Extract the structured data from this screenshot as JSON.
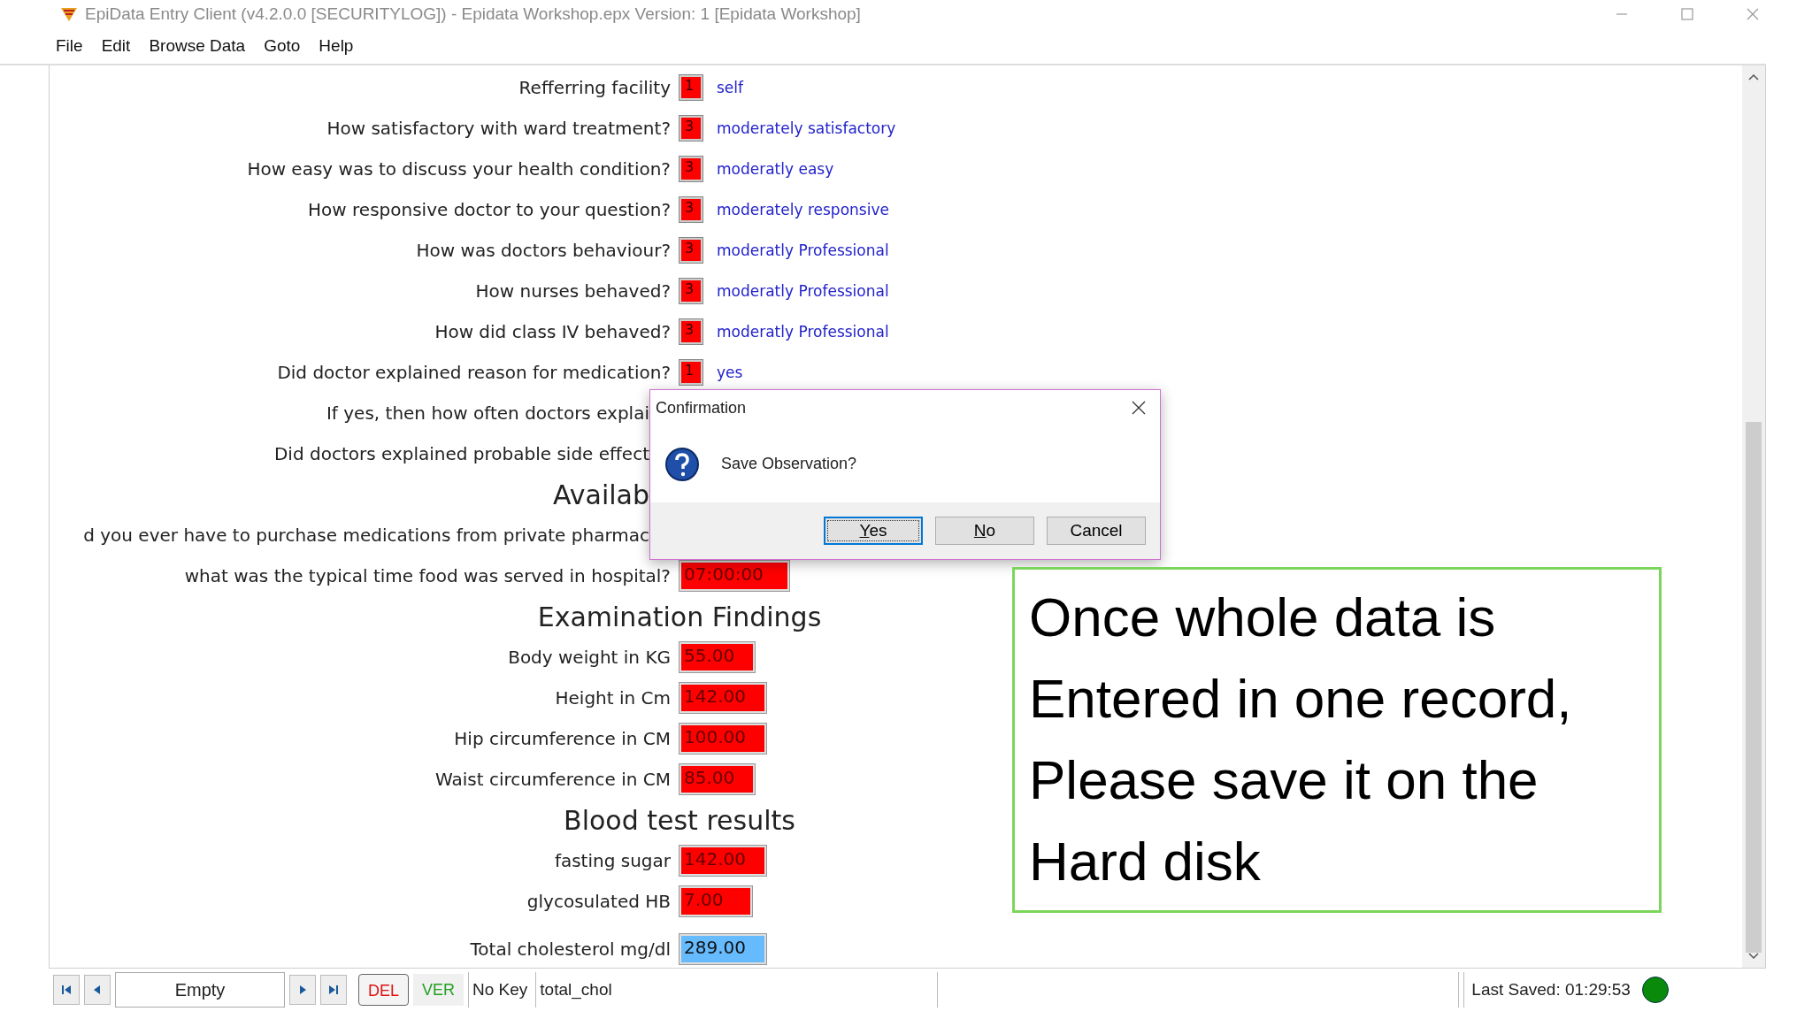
{
  "window": {
    "title": "EpiData Entry Client (v4.2.0.0 [SECURITYLOG]) - Epidata Workshop.epx Version: 1 [Epidata Workshop]"
  },
  "menu": [
    "File",
    "Edit",
    "Browse Data",
    "Goto",
    "Help"
  ],
  "form": {
    "rows": [
      {
        "kind": "code",
        "label": "Refferring facility",
        "value": "1",
        "text": "self"
      },
      {
        "kind": "code",
        "label": "How satisfactory with ward treatment?",
        "value": "3",
        "text": "moderately satisfactory"
      },
      {
        "kind": "code",
        "label": "How easy was to discuss your health condition?",
        "value": "3",
        "text": "moderatly easy"
      },
      {
        "kind": "code",
        "label": "How responsive doctor to your question?",
        "value": "3",
        "text": "moderately responsive"
      },
      {
        "kind": "code",
        "label": "How was doctors behaviour?",
        "value": "3",
        "text": "moderatly Professional"
      },
      {
        "kind": "code",
        "label": "How nurses behaved?",
        "value": "3",
        "text": "moderatly Professional"
      },
      {
        "kind": "code",
        "label": "How did class IV behaved?",
        "value": "3",
        "text": "moderatly Professional"
      },
      {
        "kind": "code",
        "label": "Did doctor explained reason for medication?",
        "value": "1",
        "text": "yes"
      },
      {
        "kind": "covered",
        "label": "If yes, then how often doctors explai"
      },
      {
        "kind": "covered",
        "label": "Did doctors explained probable side effect"
      },
      {
        "kind": "covered-heading",
        "label": "Availab"
      },
      {
        "kind": "covered",
        "label": "d you ever have to purchase medications from private pharmac"
      },
      {
        "kind": "entry",
        "label": "what was the typical time food was served in hospital?",
        "value": "07:00:00",
        "focused": false
      },
      {
        "kind": "heading",
        "label": "Examination Findings"
      },
      {
        "kind": "entry",
        "label": "Body weight in KG",
        "value": "55.00",
        "focused": false
      },
      {
        "kind": "entry",
        "label": "Height in Cm",
        "value": "142.00",
        "focused": false
      },
      {
        "kind": "entry",
        "label": "Hip circumference in CM",
        "value": "100.00",
        "focused": false
      },
      {
        "kind": "entry",
        "label": "Waist circumference in CM",
        "value": "85.00",
        "focused": false
      },
      {
        "kind": "heading",
        "label": "Blood test results"
      },
      {
        "kind": "entry",
        "label": "fasting sugar",
        "value": "142.00",
        "focused": false
      },
      {
        "kind": "entry",
        "label": "glycosulated HB",
        "value": "7.00",
        "focused": false
      },
      {
        "kind": "entry",
        "label": "Total cholesterol mg/dl",
        "value": "289.00",
        "focused": true
      }
    ]
  },
  "dialog": {
    "title": "Confirmation",
    "message": "Save Observation?",
    "buttons": [
      {
        "label": "Yes",
        "mnemonic": true,
        "default": true
      },
      {
        "label": "No",
        "mnemonic": true,
        "default": false
      },
      {
        "label": "Cancel",
        "mnemonic": false,
        "default": false
      }
    ]
  },
  "callout": {
    "text": "Once whole data is\nEntered in one record,\nPlease save it on the\nHard disk"
  },
  "status_bar": {
    "record": "Empty",
    "flags": [
      {
        "label": "DEL",
        "kind": "del"
      },
      {
        "label": "VER",
        "kind": "ver"
      }
    ],
    "key": "No Key",
    "field": "total_chol",
    "last_saved": "Last Saved:  01:29:53"
  }
}
